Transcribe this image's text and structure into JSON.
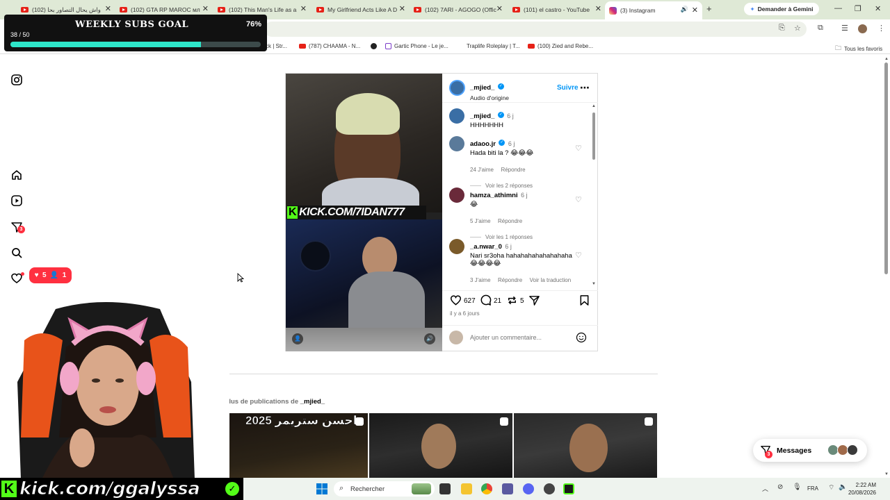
{
  "browser": {
    "tabs": [
      {
        "label": "(102) واش يحال التصاور بحا"
      },
      {
        "label": "(102) GTA RP MAROC мл"
      },
      {
        "label": "(102) This Man's Life as a"
      },
      {
        "label": "My Girlfriend Acts Like A D"
      },
      {
        "label": "(102) 7ARI - AGOGO (Offic"
      },
      {
        "label": "(101) el castro - YouTube"
      },
      {
        "label": "(3) Instagram"
      }
    ],
    "gemini_label": "Demander à Gemini",
    "bookmarks": [
      {
        "label": "ck | Str..."
      },
      {
        "label": "(787) CHAAMA - N..."
      },
      {
        "label": ""
      },
      {
        "label": "Gartic Phone - Le je..."
      },
      {
        "label": "Traplife Roleplay | T..."
      },
      {
        "label": "(100) Zied and Rebe..."
      }
    ],
    "all_favorites": "Tous les favoris"
  },
  "goal": {
    "title": "WEEKLY SUBS GOAL",
    "percent_label": "76%",
    "count": "38 / 50",
    "progress": 0.76
  },
  "nav": {
    "notif_badge": "3",
    "hearts": "5",
    "followers": "1"
  },
  "post": {
    "author": "_mjied_",
    "audio": "Audio d'origine",
    "follow": "Suivre",
    "video_overlay": "KICK.COM/7IDAN777",
    "caption": {
      "user": "_mjied_",
      "time": "6 j",
      "text": "HHHHHHH"
    },
    "comments": [
      {
        "user": "adaoo.jr",
        "time": "6 j",
        "text": "Hada biti la ? 😂😂😂",
        "likes": "24 J'aime",
        "reply": "Répondre",
        "more": "Voir les 2 réponses"
      },
      {
        "user": "hamza_athimni",
        "time": "6 j",
        "text": "😂",
        "likes": "5 J'aime",
        "reply": "Répondre",
        "more": "Voir les 1 réponses"
      },
      {
        "user": "_a.nwar_0",
        "time": "6 j",
        "text": "Nari sr3oha hahahahahahahahaha 😂😂😂😂",
        "likes": "3 J'aime",
        "reply": "Répondre",
        "translate": "Voir la traduction"
      }
    ],
    "like_count": "627",
    "comment_count": "21",
    "repost_count": "5",
    "posted": "il y a 6 jours",
    "add_comment_placeholder": "Ajouter un commentaire..."
  },
  "more": {
    "prefix": "Plus de publications de ",
    "user": "_mjied_",
    "thumb1_text": "احسن ستريمر 2025"
  },
  "messages": {
    "label": "Messages",
    "badge": "3"
  },
  "stream": {
    "kick_link": "kick.com/ggalyssa"
  },
  "taskbar": {
    "search": "Rechercher",
    "lang": "FRA",
    "time": "2:22 AM",
    "date": "20/08/2026"
  },
  "colors": {
    "accent": "#0095f6",
    "kick_green": "#53fc18",
    "goal_fill": "#2ee6c9",
    "notif_red": "#ff3040"
  }
}
